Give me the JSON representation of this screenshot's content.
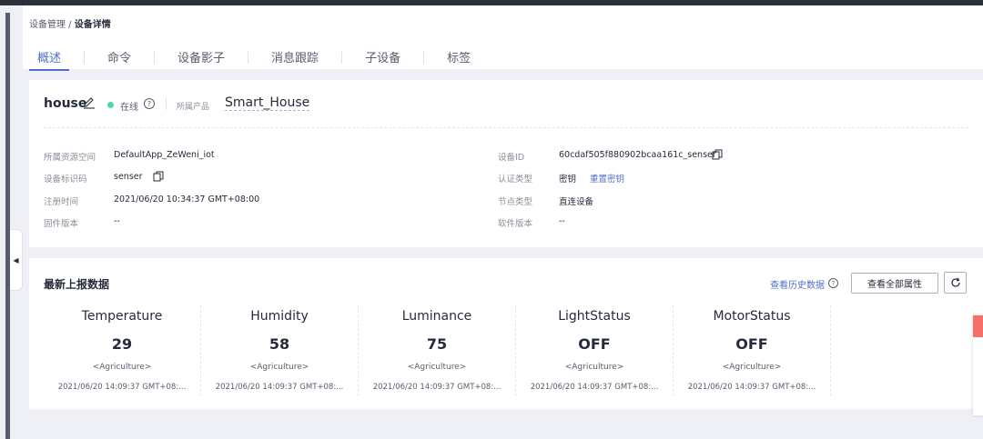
{
  "breadcrumb": {
    "parent": "设备管理",
    "separator": " / ",
    "current": "设备详情"
  },
  "tabs": [
    "概述",
    "命令",
    "设备影子",
    "消息跟踪",
    "子设备",
    "标签"
  ],
  "device": {
    "name": "house",
    "status": "在线",
    "product_label": "所属产品",
    "product_value": "Smart_House"
  },
  "info": {
    "space_label": "所属资源空间",
    "space_value": "DefaultApp_ZeWeni_iot",
    "identifier_label": "设备标识码",
    "identifier_value": "senser",
    "register_label": "注册时间",
    "register_value": "2021/06/20 10:34:37 GMT+08:00",
    "firmware_label": "固件版本",
    "firmware_value": "--",
    "id_label": "设备ID",
    "id_value": "60cdaf505f880902bcaa161c_senser",
    "auth_label": "认证类型",
    "auth_value": "密钥",
    "auth_link": "重置密钥",
    "node_label": "节点类型",
    "node_value": "直连设备",
    "software_label": "软件版本",
    "software_value": "--"
  },
  "latest": {
    "title": "最新上报数据",
    "history_link": "查看历史数据",
    "all_button": "查看全部属性",
    "properties": [
      {
        "name": "Temperature",
        "value": "29",
        "service": "<Agriculture>",
        "time": "2021/06/20 14:09:37 GMT+08:..."
      },
      {
        "name": "Humidity",
        "value": "58",
        "service": "<Agriculture>",
        "time": "2021/06/20 14:09:37 GMT+08:..."
      },
      {
        "name": "Luminance",
        "value": "75",
        "service": "<Agriculture>",
        "time": "2021/06/20 14:09:37 GMT+08:..."
      },
      {
        "name": "LightStatus",
        "value": "OFF",
        "service": "<Agriculture>",
        "time": "2021/06/20 14:09:37 GMT+08:..."
      },
      {
        "name": "MotorStatus",
        "value": "OFF",
        "service": "<Agriculture>",
        "time": "2021/06/20 14:09:37 GMT+08:..."
      }
    ]
  },
  "colors": {
    "accent": "#526ecc",
    "online": "#50d4ab",
    "background": "#eef0f5"
  }
}
